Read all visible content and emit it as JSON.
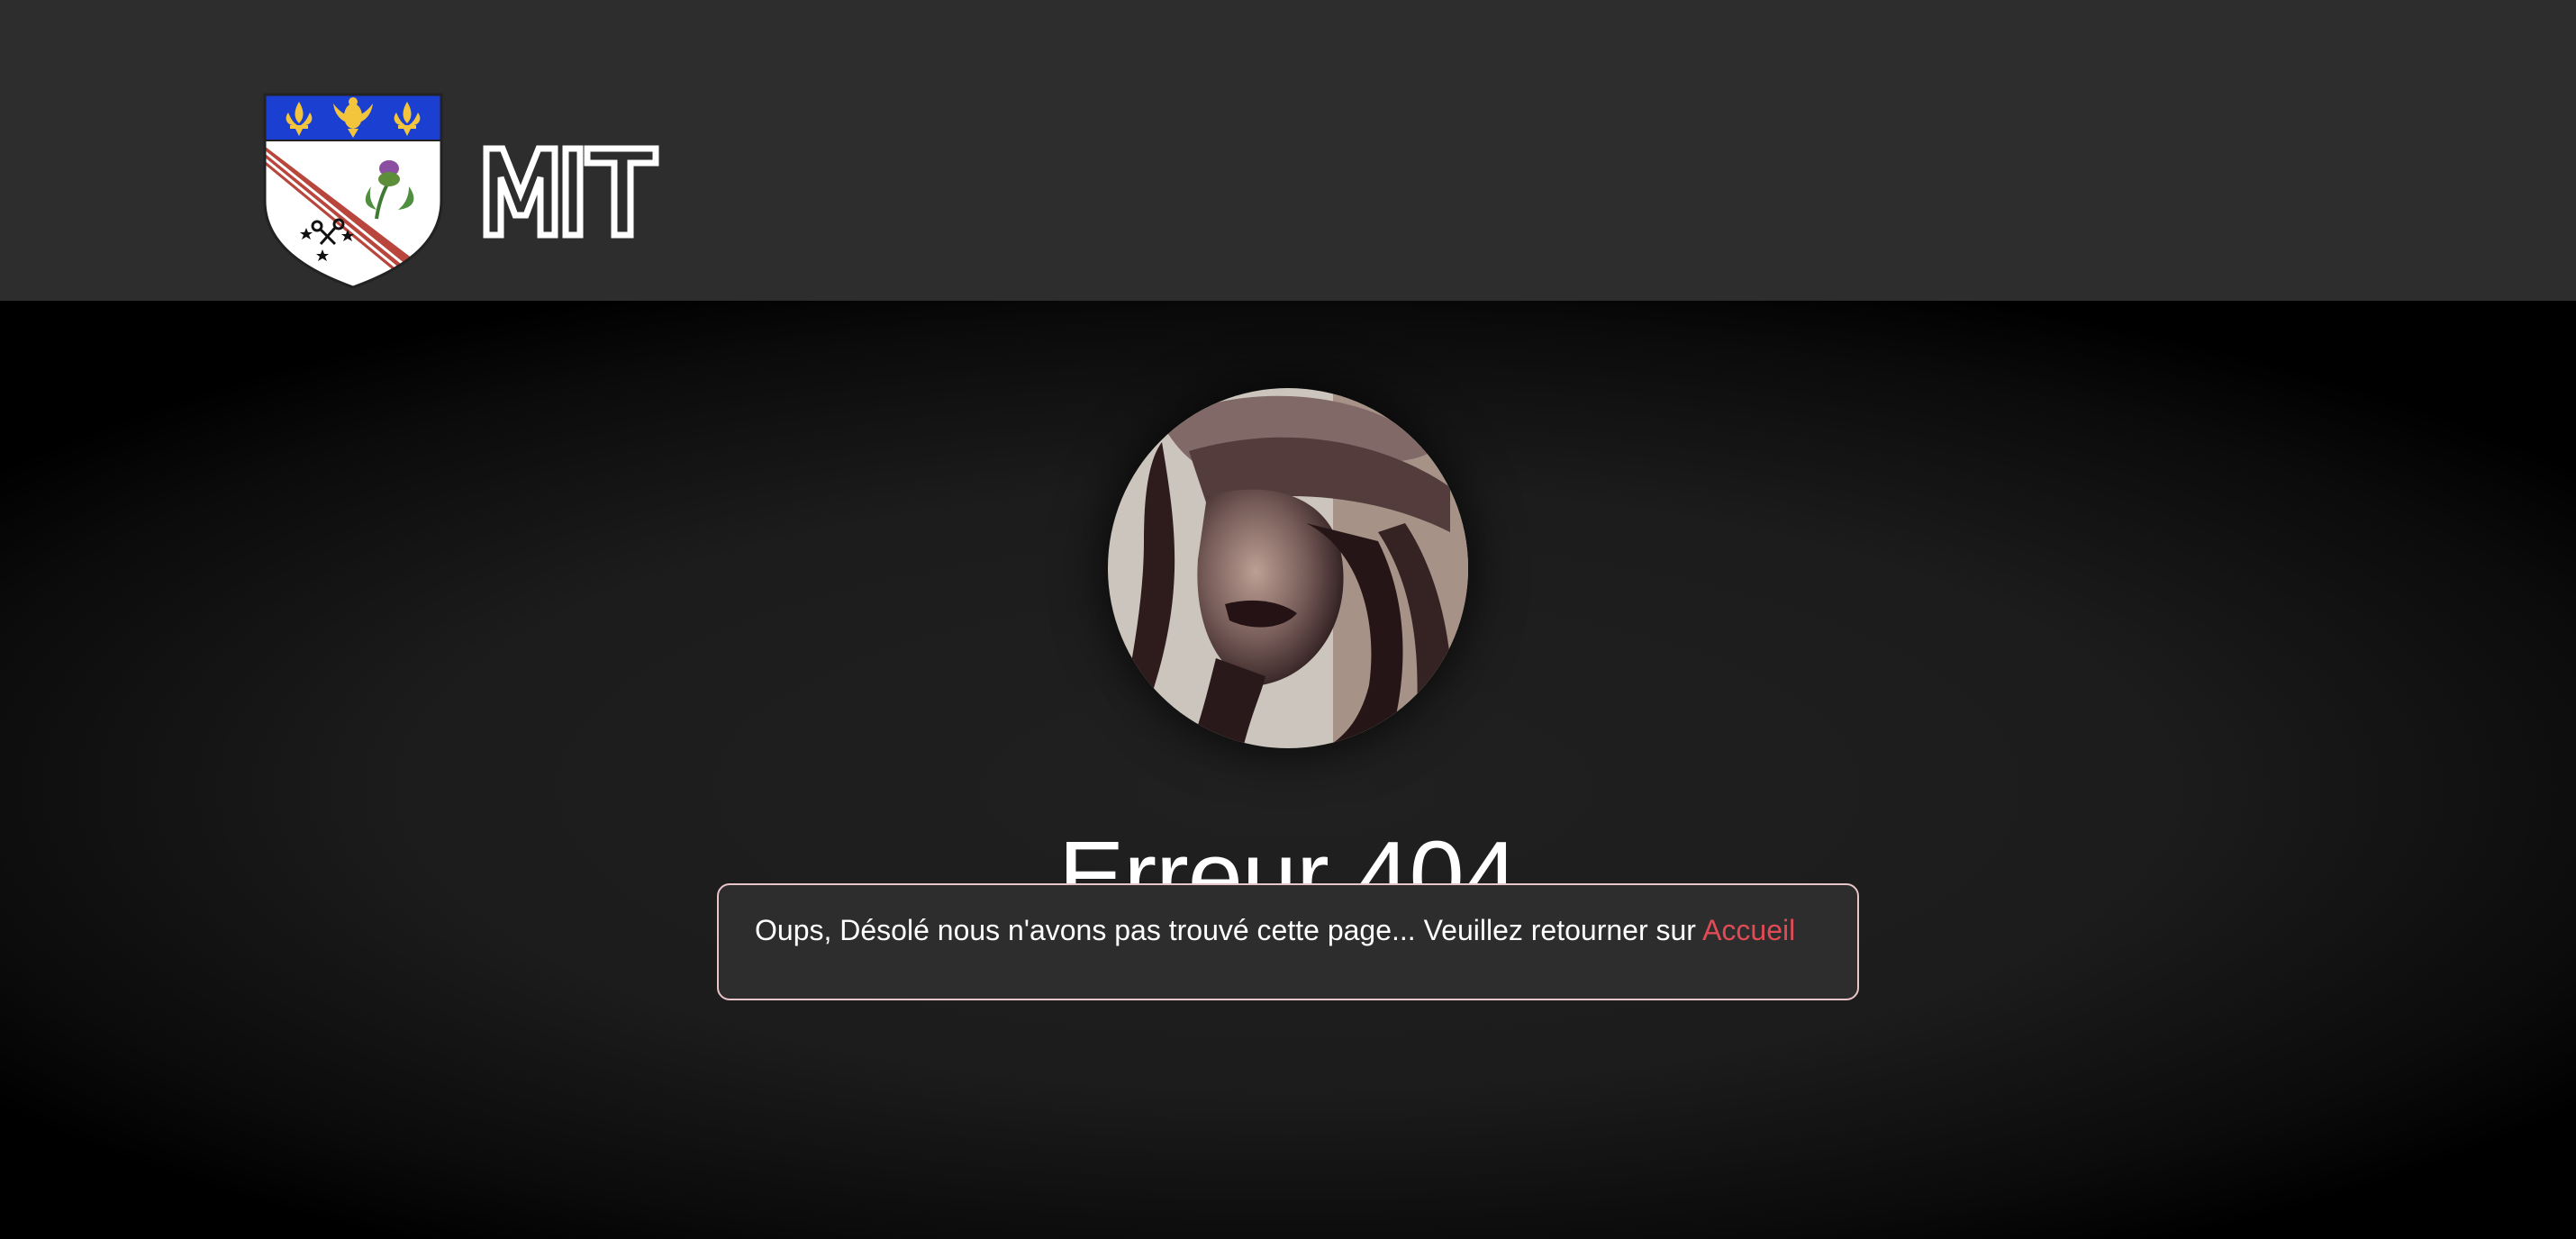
{
  "header": {
    "logo_alt": "Armoiries",
    "wordmark": "MIT"
  },
  "avatar": {
    "alt": "Photo de profil"
  },
  "error": {
    "title": "Erreur 404",
    "message": "Oups, Désolé nous n'avons pas trouvé cette page... Veuillez retourner sur ",
    "link_label": "Accueil"
  },
  "colors": {
    "header_bg": "#2d2d2d",
    "page_bg": "#000000",
    "message_bg": "#2d2d2d",
    "message_border": "#e9c4c8",
    "link": "#e04b55",
    "text": "#ffffff"
  }
}
